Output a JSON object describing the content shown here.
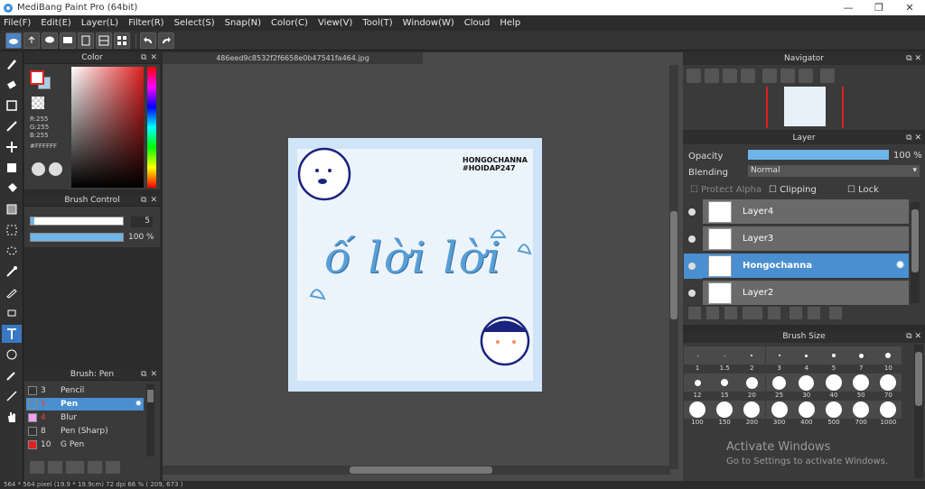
{
  "window": {
    "title": "MediBang Paint Pro (64bit)",
    "controls": [
      "—",
      "❐",
      "✕"
    ]
  },
  "menu": [
    "File(F)",
    "Edit(E)",
    "Layer(L)",
    "Filter(R)",
    "Select(S)",
    "Snap(N)",
    "Color(C)",
    "View(V)",
    "Tool(T)",
    "Window(W)",
    "Cloud",
    "Help"
  ],
  "tabs": {
    "file": "486eed9c8532f2f6658e0b47541fa464.jpg"
  },
  "color_panel": {
    "title": "Color",
    "r": "R:255",
    "g": "G:255",
    "b": "B:255",
    "hex": "#FFFFFF",
    "main_color": "#ffffff",
    "sub_color": "#a9cde8"
  },
  "brush_control": {
    "title": "Brush Control",
    "size": "5",
    "opacity": "100 %",
    "size_fraction": 0.04,
    "opacity_fraction": 1.0
  },
  "brush_list": {
    "title": "Brush: Pen",
    "items": [
      {
        "num": "3",
        "name": "Pencil",
        "color": "#333333"
      },
      {
        "num": "5",
        "name": "Pen",
        "color": "#4a8fd0"
      },
      {
        "num": "4",
        "name": "Blur",
        "color": "#f0a0f0"
      },
      {
        "num": "8",
        "name": "Pen (Sharp)",
        "color": "#333333"
      },
      {
        "num": "10",
        "name": "G Pen",
        "color": "#e02020"
      }
    ]
  },
  "artwork": {
    "signature": "HONGOCHANNA",
    "tag": "#HOIDAP247",
    "script": "ố lời lời"
  },
  "navigator": {
    "title": "Navigator"
  },
  "layer_panel": {
    "title": "Layer",
    "opacity_label": "Opacity",
    "opacity_value": "100 %",
    "blending_label": "Blending",
    "blending_value": "Normal",
    "protect_alpha": "Protect Alpha",
    "clipping": "Clipping",
    "lock": "Lock",
    "layers": [
      "Layer4",
      "Layer3",
      "Hongochanna",
      "Layer2"
    ]
  },
  "brush_size": {
    "title": "Brush Size",
    "sizes": [
      "1",
      "1.5",
      "2",
      "3",
      "4",
      "5",
      "7",
      "10",
      "12",
      "15",
      "20",
      "25",
      "30",
      "40",
      "50",
      "70",
      "100",
      "150",
      "200",
      "300",
      "400",
      "500",
      "700",
      "1000"
    ]
  },
  "watermark": {
    "line1": "Activate Windows",
    "line2": "Go to Settings to activate Windows."
  },
  "status": "564 * 564 pixel  (19.9 * 19.9cm)  72 dpi  66 %  ( 209, 673 )"
}
